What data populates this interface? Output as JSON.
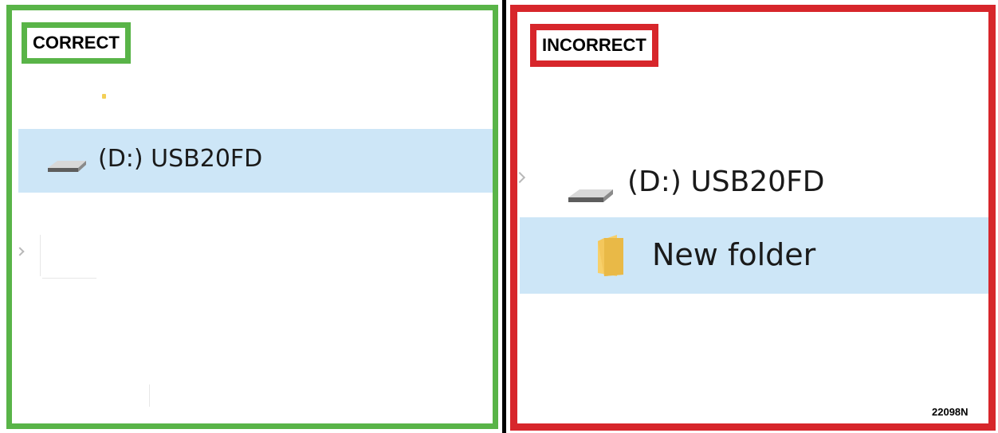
{
  "panels": {
    "correct": {
      "label": "CORRECT",
      "drive_label": "(D:) USB20FD"
    },
    "incorrect": {
      "label": "INCORRECT",
      "drive_label": "(D:) USB20FD",
      "folder_label": "New folder"
    }
  },
  "figure_code": "22098N",
  "colors": {
    "correct_border": "#59b448",
    "incorrect_border": "#d7262b",
    "selection_highlight": "#cde6f7",
    "folder": "#f4c75c"
  },
  "icons": [
    "drive-icon",
    "folder-icon",
    "chevron-right-icon"
  ]
}
